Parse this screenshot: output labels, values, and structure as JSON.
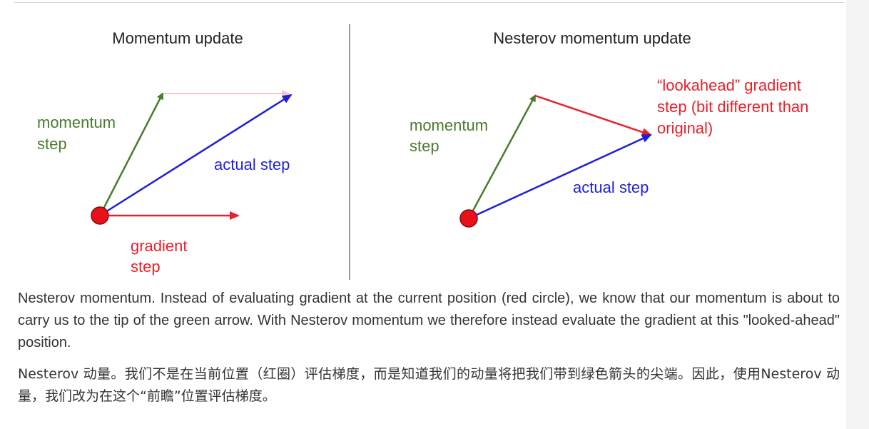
{
  "colors": {
    "momentum_arrow": "#4a7a2e",
    "gradient_arrow": "#e8202a",
    "actual_arrow": "#1f1fd6",
    "position_dot": "#e8101a",
    "faint_arrow": "#f2c8cc",
    "label_green": "#4a7a2e",
    "label_red": "#e8202a",
    "label_blue": "#1f1fd6",
    "title_text": "#222222",
    "divider": "#999999"
  },
  "left_panel": {
    "title": "Momentum update",
    "momentum_label_line1": "momentum",
    "momentum_label_line2": "step",
    "actual_label": "actual step",
    "gradient_label_line1": "gradient",
    "gradient_label_line2": "step"
  },
  "right_panel": {
    "title": "Nesterov momentum update",
    "momentum_label_line1": "momentum",
    "momentum_label_line2": "step",
    "actual_label": "actual step",
    "lookahead_line1": "“lookahead” gradient",
    "lookahead_line2": "step (bit different than",
    "lookahead_line3": "original)"
  },
  "caption_en": "Nesterov momentum. Instead of evaluating gradient at the current position (red circle), we know that our momentum is about to carry us to the tip of the green arrow. With Nesterov momentum we therefore instead evaluate the gradient at this \"looked-ahead\" position.",
  "caption_zh": "Nesterov 动量。我们不是在当前位置（红圈）评估梯度，而是知道我们的动量将把我们带到绿色箭头的尖端。因此，使用Nesterov 动量，我们改为在这个“前瞻”位置评估梯度。"
}
